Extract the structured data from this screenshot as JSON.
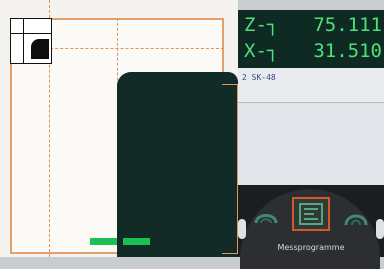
{
  "coordinates": {
    "z_axis": "Z-┐",
    "z_value": "75.111",
    "x_axis": "X-┐",
    "x_value": "31.510"
  },
  "program": {
    "line": "2  SK-48"
  },
  "softkey": {
    "label": "Messprogramme"
  },
  "progress": {
    "value_fraction": 1.0
  },
  "colors": {
    "coord_text": "#4fe07a",
    "coord_background": "#0e2a22",
    "frame": "#e3a06a",
    "workpiece": "#132b26",
    "progress": "#1bbf55",
    "softkey_highlight": "#d4582e"
  }
}
